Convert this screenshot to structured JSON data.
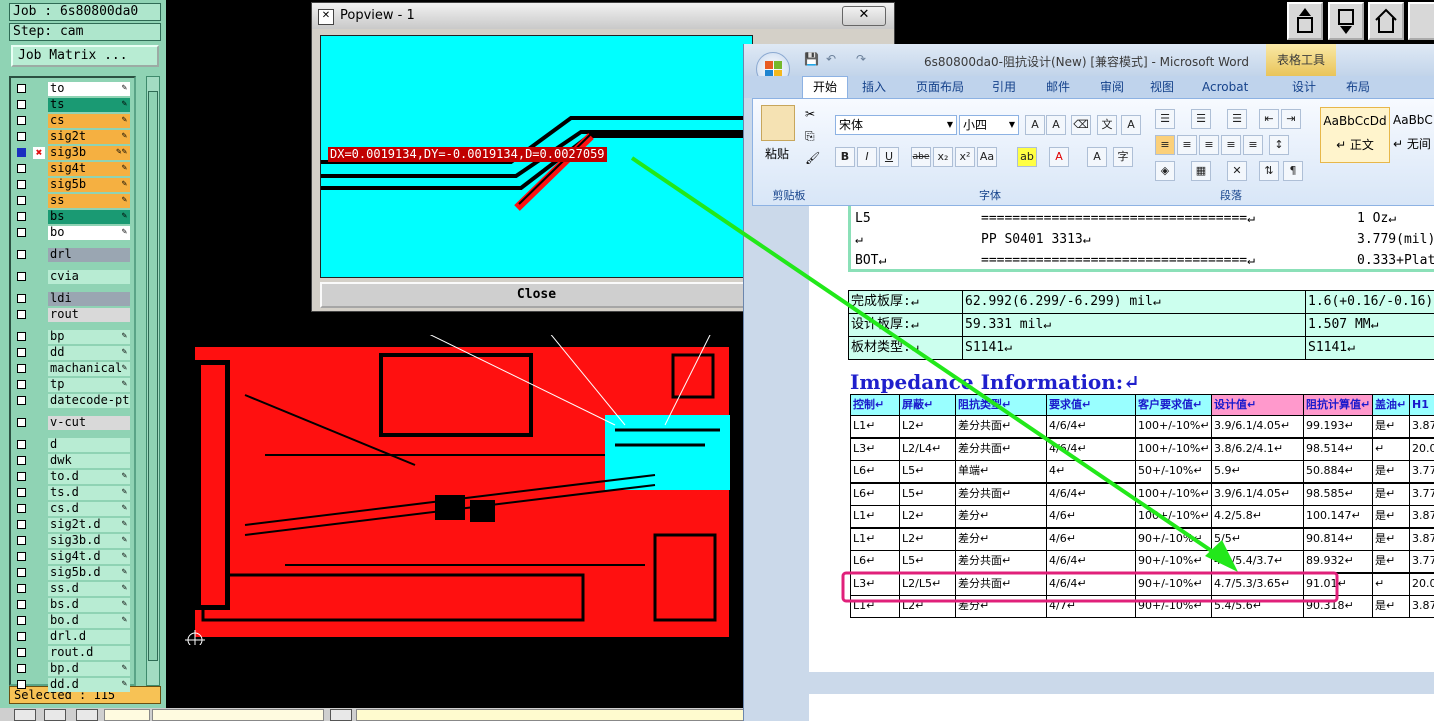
{
  "cam": {
    "job_line": "Job : 6s80800da0",
    "step_line": "Step: cam",
    "job_matrix_label": "Job Matrix ...",
    "selected_text": "Selected : 115",
    "layers": [
      {
        "name": "to",
        "color": "#ffffff",
        "checked": false,
        "marker": false,
        "badge": "✎"
      },
      {
        "name": "ts",
        "color": "#1a9a73",
        "checked": false,
        "marker": false,
        "badge": "✎"
      },
      {
        "name": "cs",
        "color": "#f5b041",
        "checked": false,
        "marker": false,
        "badge": "✎"
      },
      {
        "name": "sig2t",
        "color": "#f5b041",
        "checked": false,
        "marker": false,
        "badge": "✎"
      },
      {
        "name": "sig3b",
        "color": "#f5b041",
        "checked": true,
        "marker": true,
        "badge": "✎✎"
      },
      {
        "name": "sig4t",
        "color": "#f5b041",
        "checked": false,
        "marker": false,
        "badge": "✎"
      },
      {
        "name": "sig5b",
        "color": "#f5b041",
        "checked": false,
        "marker": false,
        "badge": "✎"
      },
      {
        "name": "ss",
        "color": "#f5b041",
        "checked": false,
        "marker": false,
        "badge": "✎"
      },
      {
        "name": "bs",
        "color": "#1a9a73",
        "checked": false,
        "marker": false,
        "badge": "✎"
      },
      {
        "name": "bo",
        "color": "#ffffff",
        "checked": false,
        "marker": false,
        "badge": "✎"
      },
      {
        "name": "drl",
        "color": "#9aa6b2",
        "checked": false,
        "marker": false,
        "badge": ""
      },
      {
        "name": "cvia",
        "color": "#b8ecd3",
        "checked": false,
        "marker": false,
        "badge": ""
      },
      {
        "name": "ldi",
        "color": "#9aa6b2",
        "checked": false,
        "marker": false,
        "badge": ""
      },
      {
        "name": "rout",
        "color": "#d9d9d9",
        "checked": false,
        "marker": false,
        "badge": ""
      },
      {
        "name": "bp",
        "color": "#b8ecd3",
        "checked": false,
        "marker": false,
        "badge": "✎"
      },
      {
        "name": "dd",
        "color": "#b8ecd3",
        "checked": false,
        "marker": false,
        "badge": "✎"
      },
      {
        "name": "machanical",
        "color": "#b8ecd3",
        "checked": false,
        "marker": false,
        "badge": "✎"
      },
      {
        "name": "tp",
        "color": "#b8ecd3",
        "checked": false,
        "marker": false,
        "badge": "✎"
      },
      {
        "name": "datecode-pto",
        "color": "#b8ecd3",
        "checked": false,
        "marker": false,
        "badge": ""
      },
      {
        "name": "v-cut",
        "color": "#d9d9d9",
        "checked": false,
        "marker": false,
        "badge": ""
      },
      {
        "name": "d",
        "color": "#b8ecd3",
        "checked": false,
        "marker": false,
        "badge": ""
      },
      {
        "name": "dwk",
        "color": "#b8ecd3",
        "checked": false,
        "marker": false,
        "badge": ""
      },
      {
        "name": "to.d",
        "color": "#b8ecd3",
        "checked": false,
        "marker": false,
        "badge": "✎"
      },
      {
        "name": "ts.d",
        "color": "#b8ecd3",
        "checked": false,
        "marker": false,
        "badge": "✎"
      },
      {
        "name": "cs.d",
        "color": "#b8ecd3",
        "checked": false,
        "marker": false,
        "badge": "✎"
      },
      {
        "name": "sig2t.d",
        "color": "#b8ecd3",
        "checked": false,
        "marker": false,
        "badge": "✎"
      },
      {
        "name": "sig3b.d",
        "color": "#b8ecd3",
        "checked": false,
        "marker": false,
        "badge": "✎"
      },
      {
        "name": "sig4t.d",
        "color": "#b8ecd3",
        "checked": false,
        "marker": false,
        "badge": "✎"
      },
      {
        "name": "sig5b.d",
        "color": "#b8ecd3",
        "checked": false,
        "marker": false,
        "badge": "✎"
      },
      {
        "name": "ss.d",
        "color": "#b8ecd3",
        "checked": false,
        "marker": false,
        "badge": "✎"
      },
      {
        "name": "bs.d",
        "color": "#b8ecd3",
        "checked": false,
        "marker": false,
        "badge": "✎"
      },
      {
        "name": "bo.d",
        "color": "#b8ecd3",
        "checked": false,
        "marker": false,
        "badge": "✎"
      },
      {
        "name": "drl.d",
        "color": "#b8ecd3",
        "checked": false,
        "marker": false,
        "badge": ""
      },
      {
        "name": "rout.d",
        "color": "#b8ecd3",
        "checked": false,
        "marker": false,
        "badge": ""
      },
      {
        "name": "bp.d",
        "color": "#b8ecd3",
        "checked": false,
        "marker": false,
        "badge": "✎"
      },
      {
        "name": "dd.d",
        "color": "#b8ecd3",
        "checked": false,
        "marker": false,
        "badge": "✎"
      }
    ]
  },
  "popview": {
    "title": "Popview - 1",
    "close_icon": "✕",
    "measurement": "DX=0.0019134,DY=-0.0019134,D=0.0027059",
    "close_label": "Close"
  },
  "word": {
    "title": "6s80800da0-阻抗设计(New) [兼容模式] - Microsoft Word",
    "table_tools": "表格工具",
    "tabs": [
      "开始",
      "插入",
      "页面布局",
      "引用",
      "邮件",
      "审阅",
      "视图",
      "Acrobat",
      "设计",
      "布局"
    ],
    "ribbon": {
      "paste_label": "粘贴",
      "clipboard_label": "剪贴板",
      "font_name": "宋体",
      "font_size": "小四",
      "font_label": "字体",
      "paragraph_label": "段落",
      "style_normal_preview": "AaBbCcDd",
      "style_normal_name": "↵ 正文",
      "style_nospace_preview": "AaBbC",
      "style_nospace_name": "↵ 无间"
    },
    "stackup": [
      {
        "layer": "L5",
        "line": "==================================↵",
        "value": "1 Oz↵"
      },
      {
        "layer": "↵",
        "line": "PP     S0401    3313↵",
        "value": "3.779(mil)"
      },
      {
        "layer": "BOT↵",
        "line": "==================================↵",
        "value": "0.333+Plat"
      }
    ],
    "props": [
      [
        "完成板厚:↵",
        "62.992(6.299/-6.299) mil↵",
        "1.6(+0.16/-0.16)"
      ],
      [
        "设计板厚:↵",
        "59.331 mil↵",
        "1.507 MM↵"
      ],
      [
        "板材类型:↵",
        "S1141↵",
        "S1141↵"
      ]
    ],
    "impedance_title": "Impedance Information:↵",
    "imp_headers": [
      "控制↵",
      "屏蔽↵",
      "阻抗类型↵",
      "要求值↵",
      "客户要求值↵",
      "设计值↵",
      "阻抗计算值↵",
      "盖油↵",
      "H1"
    ],
    "imp_rows": [
      [
        "L1↵",
        "L2↵",
        "差分共面↵",
        "4/6/4↵",
        "100+/-10%↵",
        "3.9/6.1/4.05↵",
        "99.193↵",
        "是↵",
        "3.87"
      ],
      [
        "L3↵",
        "L2/L4↵",
        "差分共面↵",
        "4/6/4↵",
        "100+/-10%↵",
        "3.8/6.2/4.1↵",
        "98.514↵",
        "↵",
        "20.0"
      ],
      [
        "L6↵",
        "L5↵",
        "单端↵",
        "4↵",
        "50+/-10%↵",
        "5.9↵",
        "50.884↵",
        "是↵",
        "3.77"
      ],
      [
        "L6↵",
        "L5↵",
        "差分共面↵",
        "4/6/4↵",
        "100+/-10%↵",
        "3.9/6.1/4.05↵",
        "98.585↵",
        "是↵",
        "3.77"
      ],
      [
        "L1↵",
        "L2↵",
        "差分↵",
        "4/6↵",
        "100+/-10%↵",
        "4.2/5.8↵",
        "100.147↵",
        "是↵",
        "3.87"
      ],
      [
        "L1↵",
        "L2↵",
        "差分↵",
        "4/6↵",
        "90+/-10%↵",
        "5/5↵",
        "90.814↵",
        "是↵",
        "3.87"
      ],
      [
        "L6↵",
        "L5↵",
        "差分共面↵",
        "4/6/4↵",
        "90+/-10%↵",
        "4.5/5.4/3.7↵",
        "89.932↵",
        "是↵",
        "3.77"
      ],
      [
        "L3↵",
        "L2/L5↵",
        "差分共面↵",
        "4/6/4↵",
        "90+/-10%↵",
        "4.7/5.3/3.65↵",
        "91.01↵",
        "↵",
        "20.0"
      ],
      [
        "L1↵",
        "L2↵",
        "差分↵",
        "4/7↵",
        "90+/-10%↵",
        "5.4/5.6↵",
        "90.318↵",
        "是↵",
        "3.87"
      ]
    ],
    "highlighted_row": 7
  },
  "colors": {
    "cam_bg": "#8fd3b4",
    "pcb_red": "#ff1010",
    "pop_cyan": "#00ffff",
    "arrow_green": "#22e81a",
    "highlight_magenta": "#e0207a",
    "header_pink": "#ff99cc",
    "header_cyan": "#99ffff"
  }
}
